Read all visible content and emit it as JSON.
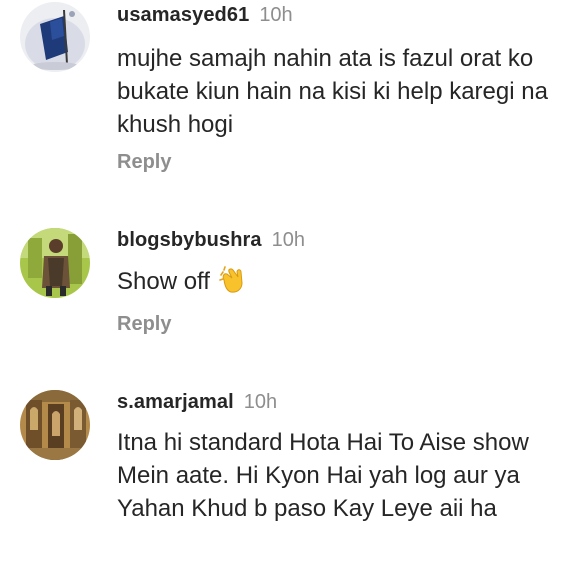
{
  "comments": [
    {
      "username": "usamasyed61",
      "time": "10h",
      "text": "mujhe samajh nahin ata is fazul orat ko bukate kiun hain na kisi ki help karegi na khush hogi",
      "reply_label": "Reply",
      "avatar_icon": "flag-avatar"
    },
    {
      "username": "blogsbybushra",
      "time": "10h",
      "text": "Show off",
      "emoji": "clapping-hands-icon",
      "reply_label": "Reply",
      "avatar_icon": "person-photo-avatar"
    },
    {
      "username": "s.amarjamal",
      "time": "10h",
      "text": "Itna hi standard Hota Hai To Aise show Mein aate. Hi Kyon Hai yah log aur  ya Yahan Khud b paso Kay Leye aii ha",
      "avatar_icon": "ornate-door-avatar"
    }
  ]
}
